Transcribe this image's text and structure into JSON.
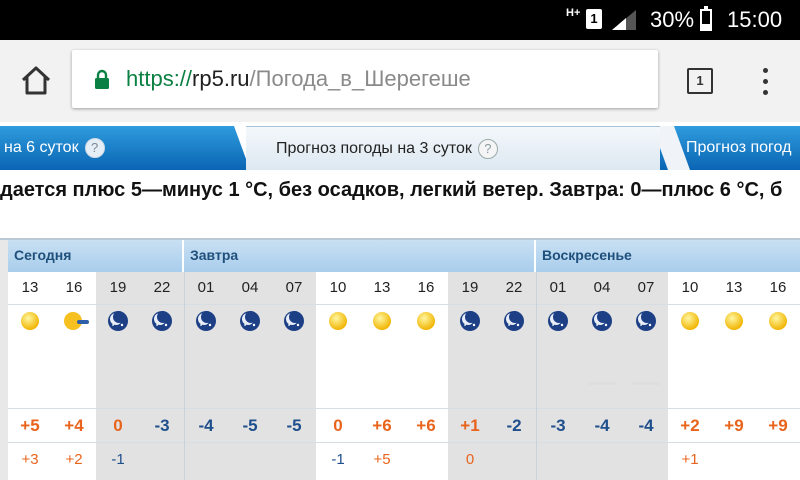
{
  "status_bar": {
    "network": "H+",
    "sim": "1",
    "battery_percent": "30%",
    "battery_level": 0.3,
    "time": "15:00"
  },
  "browser": {
    "url_scheme": "https://",
    "url_host": "rp5.ru",
    "url_path": "/Погода_в_Шерегеше",
    "tab_count": "1",
    "icons": [
      "home-icon",
      "lock-icon",
      "tabs-icon",
      "menu-icon"
    ]
  },
  "tabs": {
    "left": "на 6 суток",
    "active": "Прогноз погоды на 3 суток",
    "right": "Прогноз погод",
    "help": "?"
  },
  "summary": "дается плюс 5—минус 1 °С, без осадков, легкий ветер. Завтра: 0—плюс 6 °С, б",
  "forecast": {
    "days": [
      "Сегодня",
      "Завтра",
      "Воскресенье"
    ],
    "hours": [
      "13",
      "16",
      "19",
      "22",
      "01",
      "04",
      "07",
      "10",
      "13",
      "16",
      "19",
      "22",
      "01",
      "04",
      "07",
      "10",
      "13",
      "16"
    ],
    "temps": [
      "+5",
      "+4",
      "0",
      "-3",
      "-4",
      "-5",
      "-5",
      "0",
      "+6",
      "+6",
      "+1",
      "-2",
      "-3",
      "-4",
      "-4",
      "+2",
      "+9",
      "+9"
    ],
    "feels": [
      "+3",
      "+2",
      "-1",
      "",
      "",
      "",
      "",
      "-1",
      "+5",
      "",
      "0",
      "",
      "",
      "",
      "",
      "+1",
      "",
      ""
    ],
    "icons": [
      "sun",
      "sun-cloud",
      "moon",
      "moon",
      "moon",
      "moon",
      "moon",
      "sun",
      "sun",
      "sun",
      "moon",
      "moon",
      "moon",
      "moon",
      "moon",
      "sun",
      "sun",
      "sun"
    ],
    "colors": {
      "warm": "#e8641c",
      "cold": "#1f4f8c",
      "night_bg": "#e2e2e2",
      "day_header": "#a9cdec"
    }
  }
}
